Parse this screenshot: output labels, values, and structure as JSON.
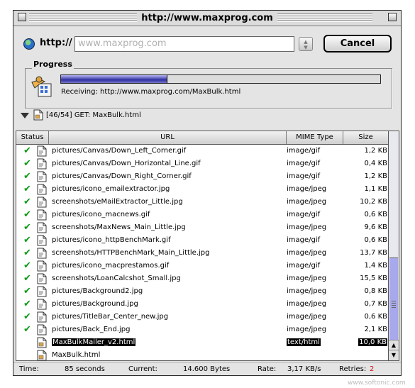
{
  "window": {
    "title": "http://www.maxprog.com"
  },
  "url_bar": {
    "protocol": "http://",
    "value": "www.maxprog.com",
    "cancel_label": "Cancel"
  },
  "progress": {
    "label": "Progress",
    "fraction": 0.33,
    "receiving_text": "Receiving: http://www.maxprog.com/MaxBulk.html"
  },
  "current_request": {
    "counter": "[46/54]",
    "text": "GET: MaxBulk.html"
  },
  "table": {
    "columns": [
      "Status",
      "URL",
      "MIME Type",
      "Size"
    ],
    "rows": [
      {
        "status": "done",
        "url": "pictures/Canvas/Down_Left_Corner.gif",
        "mime": "image/gif",
        "size": "1,2 KB"
      },
      {
        "status": "done",
        "url": "pictures/Canvas/Down_Horizontal_Line.gif",
        "mime": "image/gif",
        "size": "0,4 KB"
      },
      {
        "status": "done",
        "url": "pictures/Canvas/Down_Right_Corner.gif",
        "mime": "image/gif",
        "size": "1,2 KB"
      },
      {
        "status": "done",
        "url": "pictures/icono_emailextractor.jpg",
        "mime": "image/jpeg",
        "size": "1,1 KB"
      },
      {
        "status": "done",
        "url": "screenshots/eMailExtractor_Little.jpg",
        "mime": "image/jpeg",
        "size": "10,2 KB"
      },
      {
        "status": "done",
        "url": "pictures/icono_macnews.gif",
        "mime": "image/gif",
        "size": "0,6 KB"
      },
      {
        "status": "done",
        "url": "screenshots/MaxNews_Main_Little.jpg",
        "mime": "image/jpeg",
        "size": "9,6 KB"
      },
      {
        "status": "done",
        "url": "pictures/icono_httpBenchMark.gif",
        "mime": "image/gif",
        "size": "0,6 KB"
      },
      {
        "status": "done",
        "url": "screenshots/HTTPBenchMark_Main_Little.jpg",
        "mime": "image/jpeg",
        "size": "13,7 KB"
      },
      {
        "status": "done",
        "url": "pictures/icono_macprestamos.gif",
        "mime": "image/gif",
        "size": "1,4 KB"
      },
      {
        "status": "done",
        "url": "screenshots/LoanCalcshot_Small.jpg",
        "mime": "image/jpeg",
        "size": "15,5 KB"
      },
      {
        "status": "done",
        "url": "pictures/Background2.jpg",
        "mime": "image/jpeg",
        "size": "0,8 KB"
      },
      {
        "status": "done",
        "url": "pictures/Background.jpg",
        "mime": "image/jpeg",
        "size": "0,7 KB"
      },
      {
        "status": "done",
        "url": "pictures/TitleBar_Center_new.jpg",
        "mime": "image/jpeg",
        "size": "0,6 KB"
      },
      {
        "status": "done",
        "url": "pictures/Back_End.jpg",
        "mime": "image/jpeg",
        "size": "2,1 KB"
      },
      {
        "status": "selected",
        "url": "MaxBulkMailer_v2.html",
        "mime": "text/html",
        "size": "10,0 KB"
      },
      {
        "status": "pending",
        "url": "MaxBulk.html",
        "mime": "",
        "size": ""
      }
    ]
  },
  "footer": {
    "time_label": "Time:",
    "time_value": "85 seconds",
    "current_label": "Current:",
    "current_value": "14.600 Bytes",
    "rate_label": "Rate:",
    "rate_value": "3,17 KB/s",
    "retries_label": "Retries:",
    "retries_value": "2"
  },
  "watermark": "www.softonic.com",
  "colors": {
    "check": "#0b9a14",
    "progress_fill": "#3030a0",
    "scroll_thumb": "#a8a8ec",
    "retries": "#d01010"
  },
  "icons": [
    "close-box-icon",
    "zoom-box-icon",
    "globe-icon",
    "process-icon",
    "disclosure-triangle-icon",
    "document-icon",
    "checkmark-icon"
  ]
}
